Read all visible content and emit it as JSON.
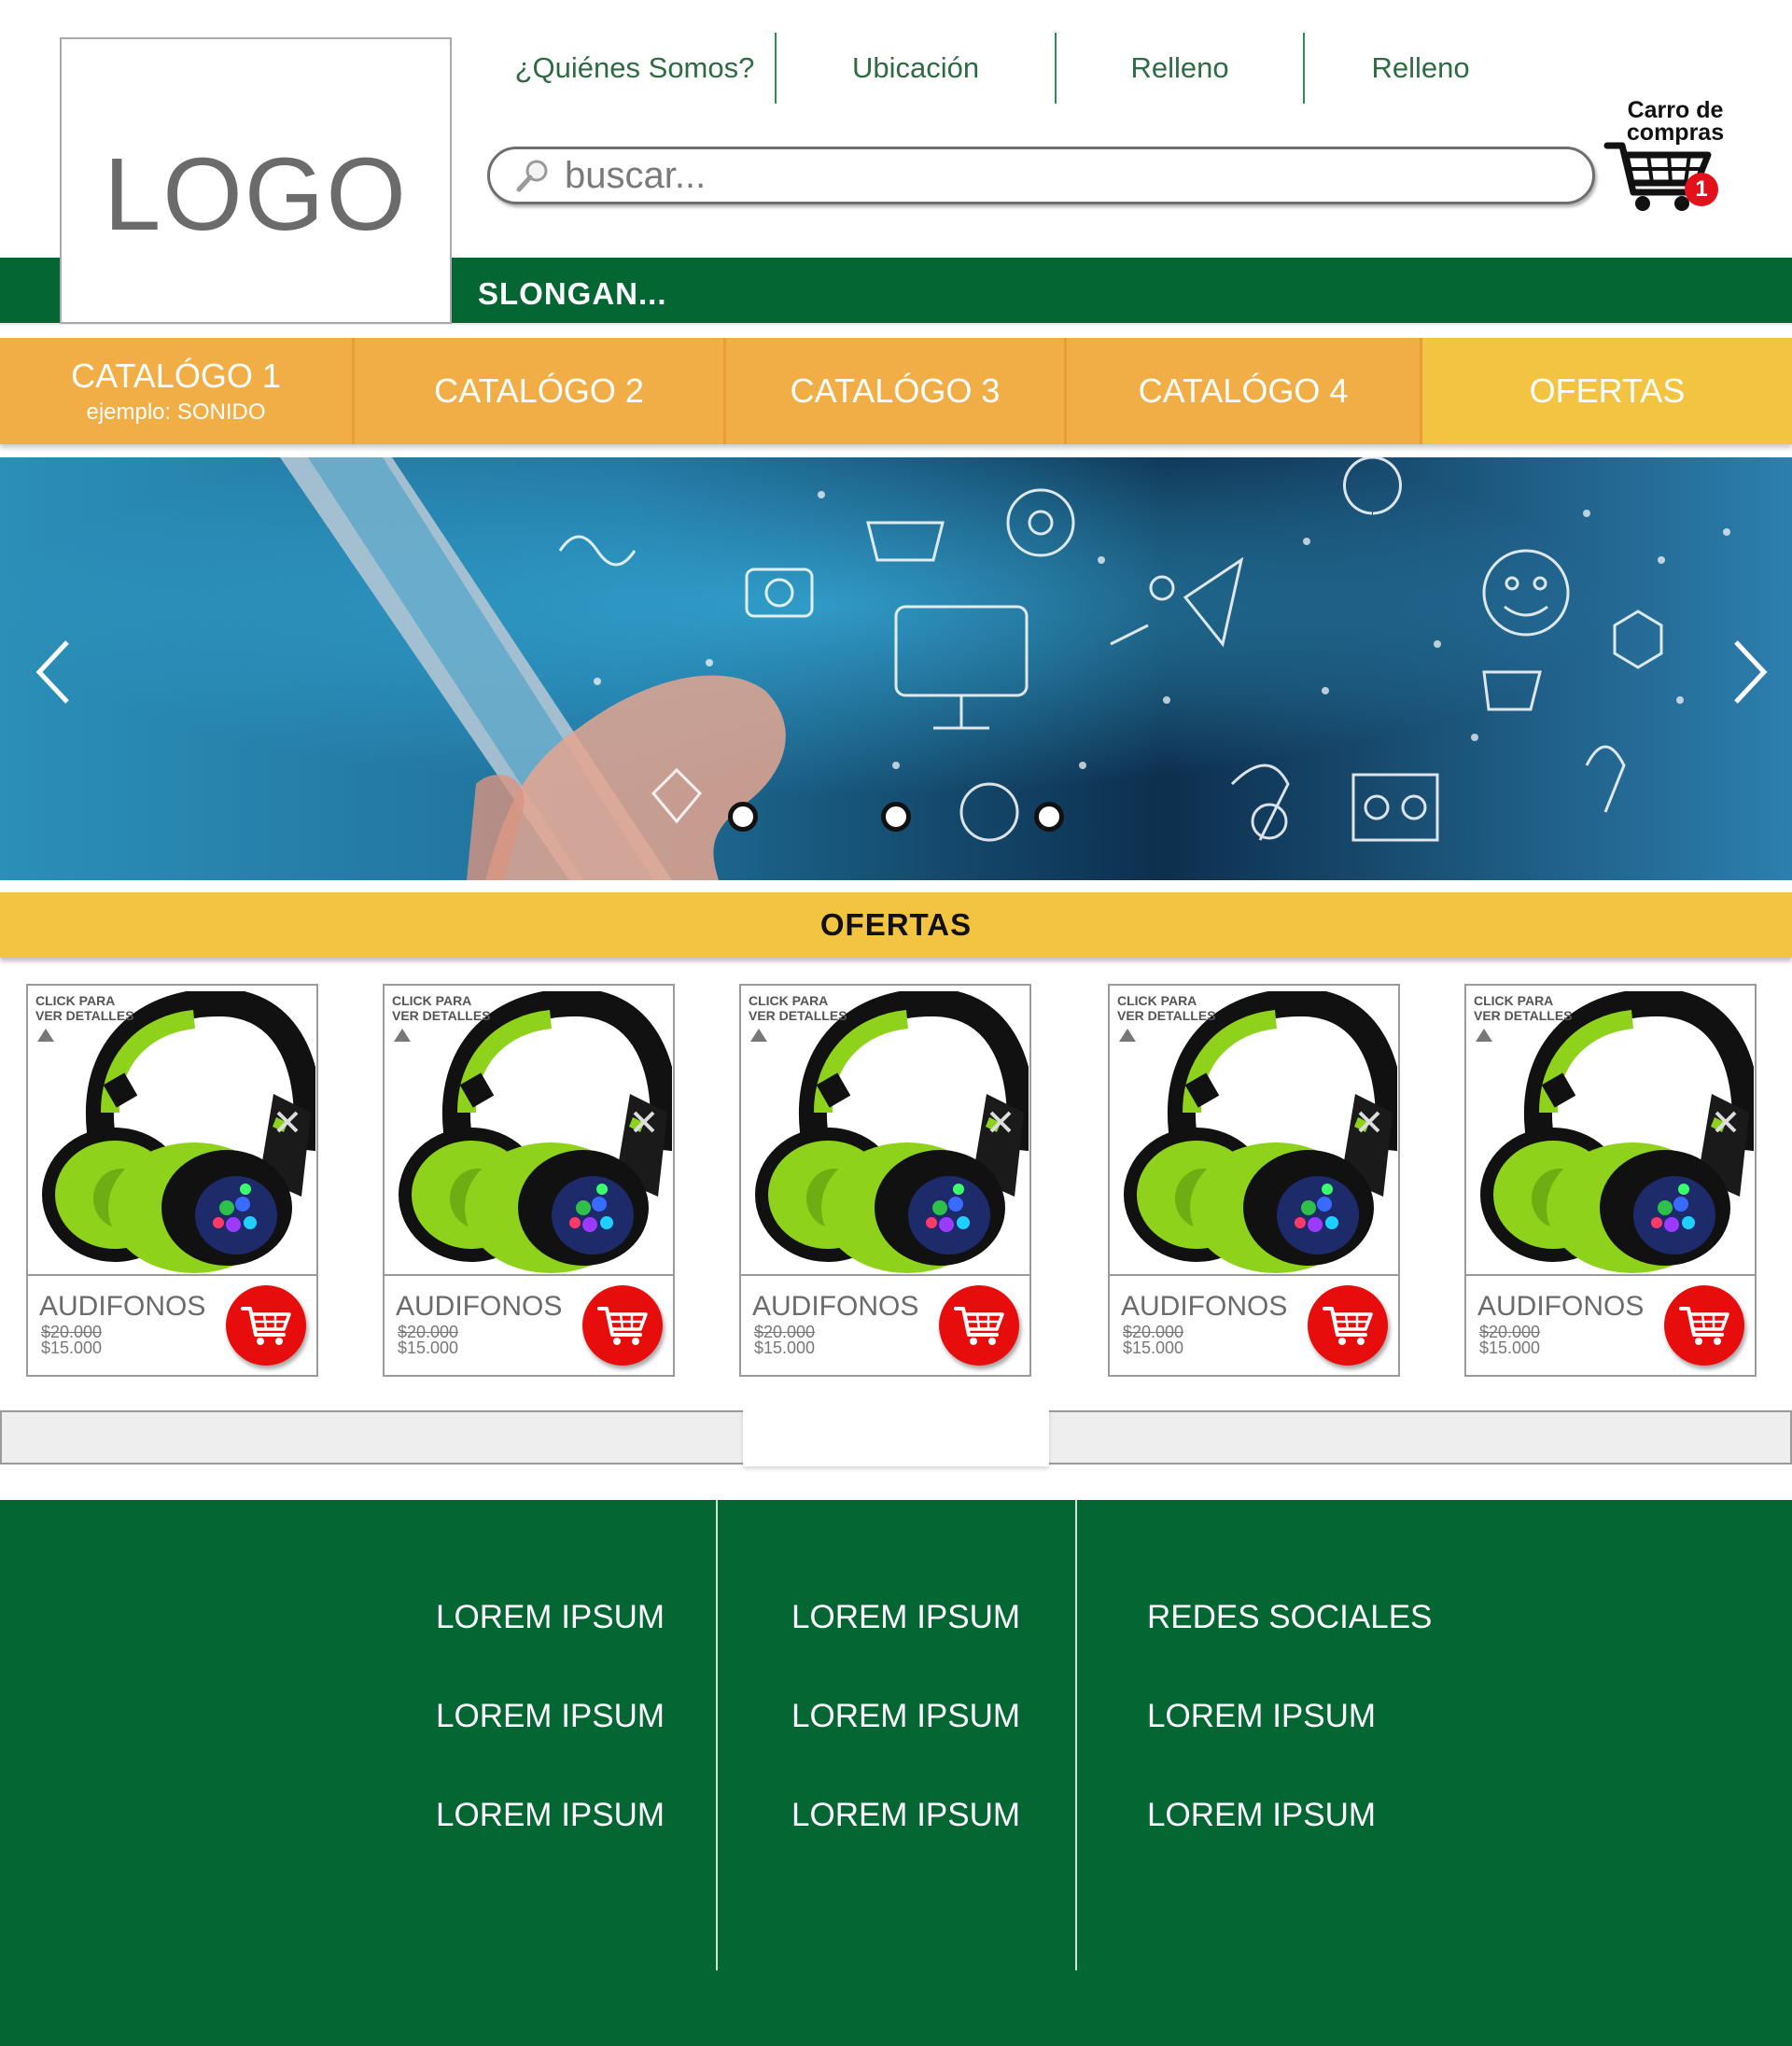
{
  "header": {
    "logo_text": "LOGO",
    "nav": [
      "¿Quiénes Somos?",
      "Ubicación",
      "Relleno",
      "Relleno"
    ],
    "search_placeholder": "buscar...",
    "cart_label_line1": "Carro de",
    "cart_label_line2": "compras",
    "cart_count": "1",
    "slogan": "SLONGAN..."
  },
  "categories": [
    {
      "label": "CATALÓGO 1",
      "sub": "ejemplo: SONIDO"
    },
    {
      "label": "CATALÓGO 2"
    },
    {
      "label": "CATALÓGO 3"
    },
    {
      "label": "CATALÓGO 4"
    },
    {
      "label": "OFERTAS"
    }
  ],
  "banner": {
    "icons": {
      "prev": "chevron-left-icon",
      "next": "chevron-right-icon"
    },
    "dots": 3
  },
  "offers": {
    "title": "OFERTAS",
    "products": [
      {
        "hint_line1": "CLICK PARA",
        "hint_line2": "VER DETALLES",
        "name": "AUDIFONOS",
        "old_price": "$20.000",
        "price": "$15.000"
      },
      {
        "hint_line1": "CLICK PARA",
        "hint_line2": "VER DETALLES",
        "name": "AUDIFONOS",
        "old_price": "$20.000",
        "price": "$15.000"
      },
      {
        "hint_line1": "CLICK PARA",
        "hint_line2": "VER DETALLES",
        "name": "AUDIFONOS",
        "old_price": "$20.000",
        "price": "$15.000"
      },
      {
        "hint_line1": "CLICK PARA",
        "hint_line2": "VER DETALLES",
        "name": "AUDIFONOS",
        "old_price": "$20.000",
        "price": "$15.000"
      },
      {
        "hint_line1": "CLICK PARA",
        "hint_line2": "VER DETALLES",
        "name": "AUDIFONOS",
        "old_price": "$20.000",
        "price": "$15.000"
      }
    ]
  },
  "footer": {
    "columns": [
      [
        "LOREM IPSUM",
        "LOREM IPSUM",
        "LOREM IPSUM"
      ],
      [
        "LOREM IPSUM",
        "LOREM IPSUM",
        "LOREM IPSUM"
      ],
      [
        "REDES SOCIALES",
        "LOREM IPSUM",
        "LOREM IPSUM"
      ]
    ]
  },
  "colors": {
    "brand_green": "#036633",
    "orange": "#f2ae46",
    "yellow": "#f3c442",
    "cart_red": "#e80d0d",
    "headphone_green": "#8fd21b"
  }
}
